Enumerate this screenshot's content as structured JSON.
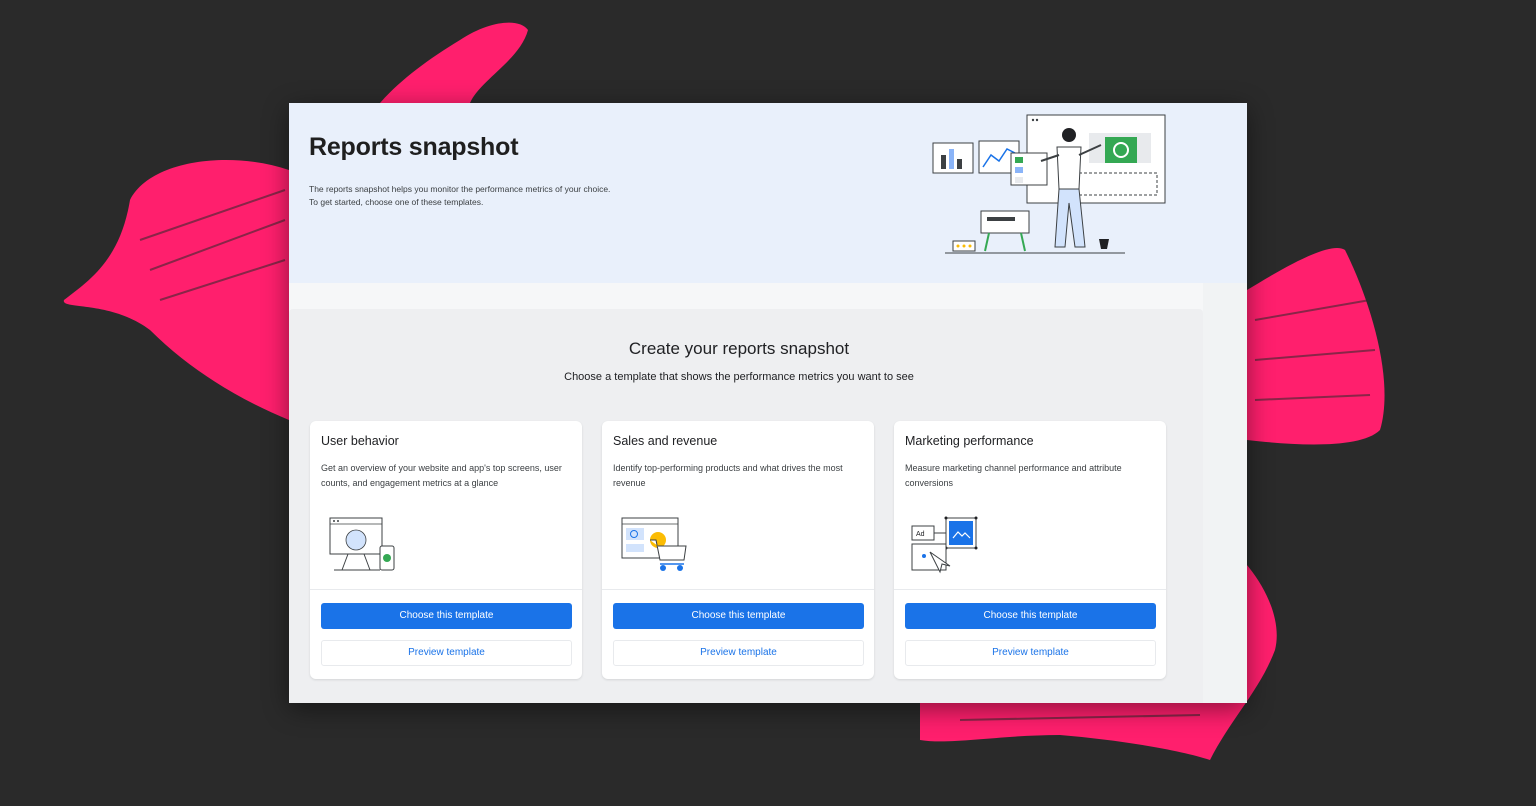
{
  "header": {
    "title": "Reports snapshot",
    "description_line1": "The reports snapshot helps you monitor the performance metrics of your choice.",
    "description_line2": "To get started, choose one of these templates.",
    "illustration": "analytics-dashboard-illustration"
  },
  "panel": {
    "title": "Create your reports snapshot",
    "subtitle": "Choose a template that shows the performance metrics you want to see"
  },
  "cards": [
    {
      "title": "User behavior",
      "description": "Get an overview of your website and app's top screens, user counts, and engagement metrics at a glance",
      "illustration": "desktop-and-phone-icon",
      "choose_label": "Choose this template",
      "preview_label": "Preview template"
    },
    {
      "title": "Sales and revenue",
      "description": "Identify top-performing products and what drives the most revenue",
      "illustration": "shopping-cart-icon",
      "choose_label": "Choose this template",
      "preview_label": "Preview template"
    },
    {
      "title": "Marketing performance",
      "description": "Measure marketing channel performance and attribute conversions",
      "illustration": "ad-cursor-icon",
      "choose_label": "Choose this template",
      "preview_label": "Preview template"
    }
  ],
  "colors": {
    "background": "#2a2a2a",
    "brush_accent": "#ff1f6d",
    "header_bg": "#e9f0fb",
    "primary_button": "#1a73e8",
    "accent_green": "#34a853",
    "accent_yellow": "#fbbc04"
  }
}
